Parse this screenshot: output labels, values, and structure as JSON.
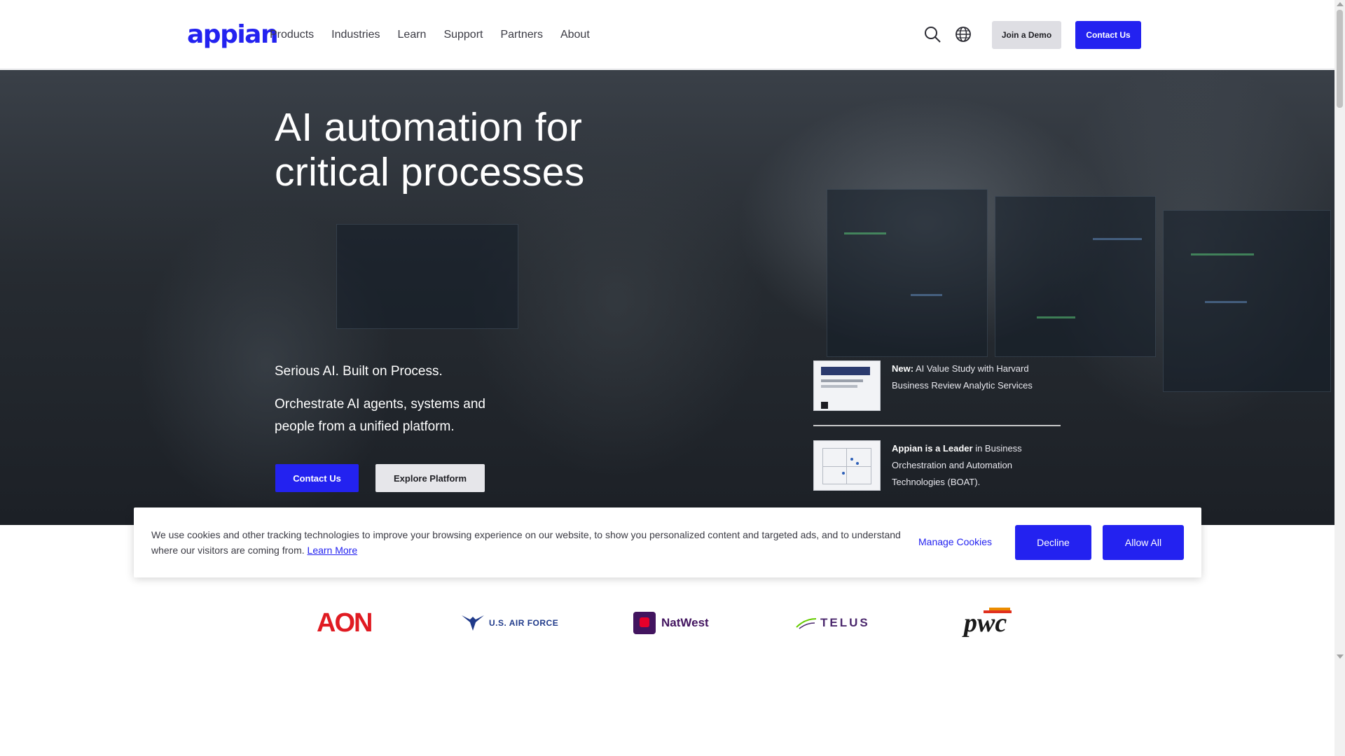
{
  "header": {
    "logo": "appian",
    "nav": [
      "Products",
      "Industries",
      "Learn",
      "Support",
      "Partners",
      "About"
    ],
    "search_icon": "search-icon",
    "globe_icon": "globe-icon",
    "join_demo_label": "Join a Demo",
    "contact_label": "Contact Us"
  },
  "hero": {
    "title_line1": "AI automation for",
    "title_line2": "critical processes",
    "tagline": "Serious AI. Built on Process.",
    "subtitle": "Orchestrate AI agents, systems and people from a unified platform.",
    "contact_label": "Contact Us",
    "explore_label": "Explore Platform",
    "promos": [
      {
        "bold": "New:",
        "text": " AI Value Study with Harvard Business Review Analytic Services"
      },
      {
        "bold": "Appian is a Leader",
        "text": " in Business Orchestration and Automation Technologies (BOAT)."
      }
    ]
  },
  "cookie_banner": {
    "text": "We use cookies and other tracking technologies to improve your browsing experience on our website, to show you personalized content and targeted ads, and to understand where our visitors are coming from.",
    "learn_more": "Learn More",
    "manage_label": "Manage Cookies",
    "decline_label": "Decline",
    "allow_label": "Allow All"
  },
  "customer_logos": {
    "aon": "AON",
    "usaf": "U.S. AIR FORCE",
    "natwest": "NatWest",
    "telus": "TELUS",
    "pwc": "pwc"
  },
  "colors": {
    "brand": "#2322f0",
    "aon": "#e01b22",
    "natwest": "#42145f",
    "telus": "#4b286d"
  }
}
